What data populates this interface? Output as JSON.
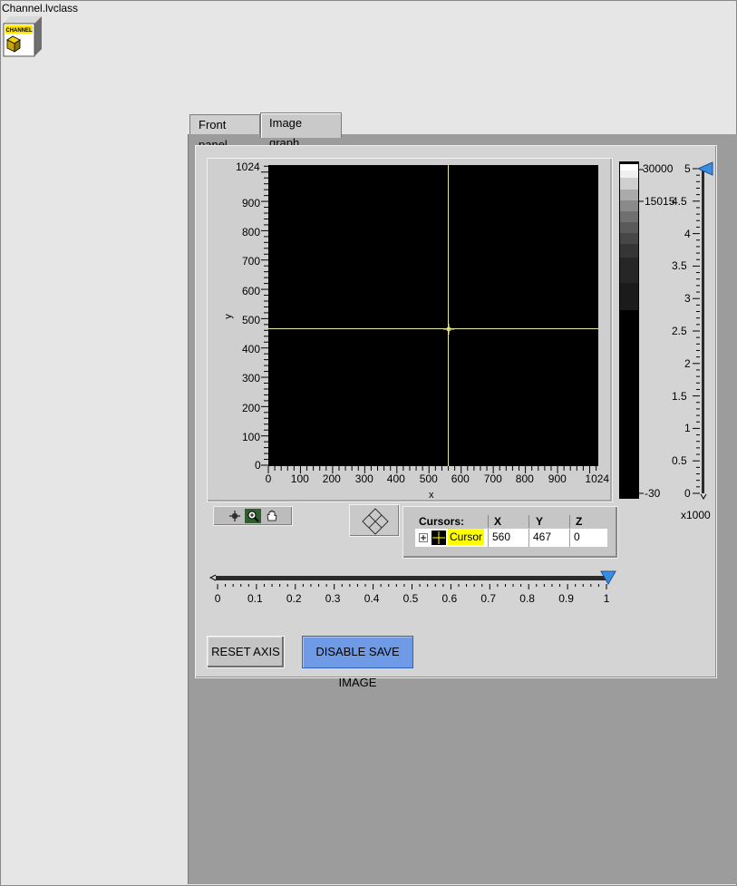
{
  "window": {
    "title": "Channel.lvclass",
    "icon": "channel-class-icon",
    "icon_text": "CHANNEL"
  },
  "tabs": [
    {
      "label": "Front panel",
      "active": false
    },
    {
      "label": "Image graph",
      "active": true
    }
  ],
  "image_graph": {
    "x_axis_label": "x",
    "y_axis_label": "y",
    "x_ticks": [
      "0",
      "100",
      "200",
      "300",
      "400",
      "500",
      "600",
      "700",
      "800",
      "900",
      "1024"
    ],
    "y_ticks": [
      "1024",
      "900",
      "800",
      "700",
      "600",
      "500",
      "400",
      "300",
      "200",
      "100",
      "0"
    ],
    "cursor_position": {
      "x": 560,
      "y": 467
    },
    "plot_color": "#000000",
    "cursor_color": "#e8e89a"
  },
  "color_scale": {
    "ticks": [
      "30000",
      "15015",
      "-30"
    ]
  },
  "vertical_slider": {
    "ticks": [
      "5",
      "4.5",
      "4",
      "3.5",
      "3",
      "2.5",
      "2",
      "1.5",
      "1",
      "0.5",
      "0"
    ],
    "multiplier": "x1000",
    "value": 5
  },
  "horizontal_slider": {
    "ticks": [
      "0",
      "0.1",
      "0.2",
      "0.3",
      "0.4",
      "0.5",
      "0.6",
      "0.7",
      "0.8",
      "0.9",
      "1"
    ],
    "value": 1
  },
  "graph_palette": {
    "tools": [
      "cursor-tool-icon",
      "zoom-icon",
      "pan-hand-icon"
    ]
  },
  "cursor_legend": {
    "headers": [
      "Cursors:",
      "X",
      "Y",
      "Z"
    ],
    "rows": [
      {
        "name": "Cursor",
        "x": "560",
        "y": "467",
        "z": "0"
      }
    ],
    "highlight_color": "#ffff00"
  },
  "buttons": {
    "reset_axis": "RESET AXIS",
    "disable_save_image": "DISABLE SAVE IMAGE"
  },
  "colors": {
    "accent": "#6f9be6",
    "slider_thumb": "#3a8ee0"
  }
}
